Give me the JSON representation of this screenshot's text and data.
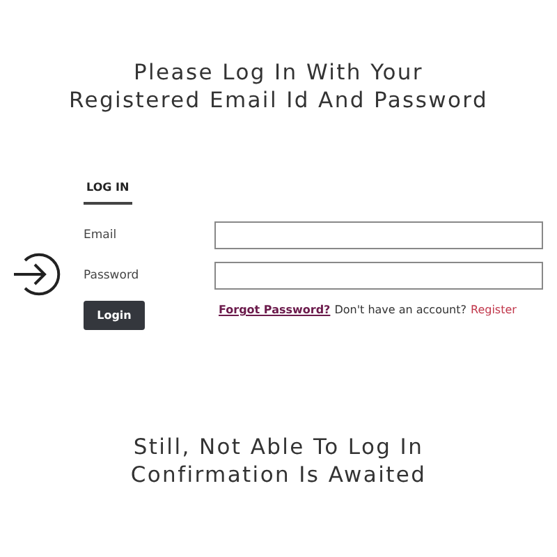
{
  "heading": [
    "Please Log In With Your",
    "Registered Email Id And Password"
  ],
  "tabs": [
    {
      "label": "LOG IN",
      "selected": true
    }
  ],
  "fields": [
    {
      "label": "Email"
    },
    {
      "label": "Password"
    }
  ],
  "login_button": "Login",
  "forgot_link": "Forgot Password?",
  "register_prompt": "Don't have an account?",
  "register_link": "Register",
  "footer": [
    "Still, Not Able To Log In",
    "Confirmation Is Awaited"
  ]
}
